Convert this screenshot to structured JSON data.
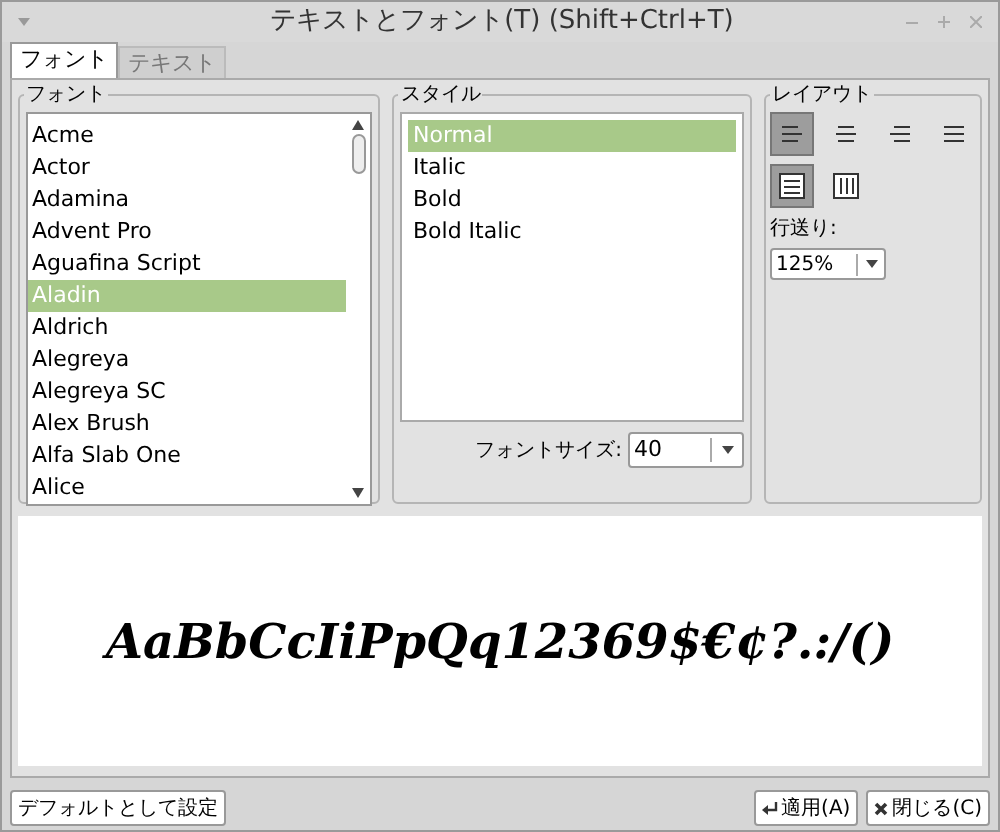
{
  "window": {
    "title": "テキストとフォント(T) (Shift+Ctrl+T)"
  },
  "tabs": [
    {
      "label": "フォント",
      "selected": true
    },
    {
      "label": "テキスト",
      "selected": false
    }
  ],
  "font_group": {
    "label": "フォント",
    "items": [
      {
        "label": "Acme",
        "selected": false
      },
      {
        "label": "Actor",
        "selected": false
      },
      {
        "label": "Adamina",
        "selected": false
      },
      {
        "label": "Advent Pro",
        "selected": false
      },
      {
        "label": "Aguafina Script",
        "selected": false
      },
      {
        "label": "Aladin",
        "selected": true
      },
      {
        "label": "Aldrich",
        "selected": false
      },
      {
        "label": "Alegreya",
        "selected": false
      },
      {
        "label": "Alegreya SC",
        "selected": false
      },
      {
        "label": "Alex Brush",
        "selected": false
      },
      {
        "label": "Alfa Slab One",
        "selected": false
      },
      {
        "label": "Alice",
        "selected": false
      }
    ]
  },
  "style_group": {
    "label": "スタイル",
    "items": [
      {
        "label": "Normal",
        "selected": true
      },
      {
        "label": "Italic",
        "selected": false
      },
      {
        "label": "Bold",
        "selected": false
      },
      {
        "label": "Bold Italic",
        "selected": false
      }
    ],
    "size_label": "フォントサイズ:",
    "size_value": "40"
  },
  "layout_group": {
    "label": "レイアウト",
    "alignments": [
      {
        "kind": "left",
        "selected": true
      },
      {
        "kind": "center",
        "selected": false
      },
      {
        "kind": "right",
        "selected": false
      },
      {
        "kind": "justify",
        "selected": false
      }
    ],
    "modes": [
      {
        "kind": "horizontal",
        "selected": true
      },
      {
        "kind": "vertical",
        "selected": false
      }
    ],
    "spacing_label": "行送り:",
    "spacing_value": "125%"
  },
  "preview": {
    "text": "AaBbCcIiPpQq12369$€¢?.:/()"
  },
  "buttons": {
    "default": "デフォルトとして設定",
    "apply": "適用(A)",
    "close": "閉じる(C)"
  }
}
